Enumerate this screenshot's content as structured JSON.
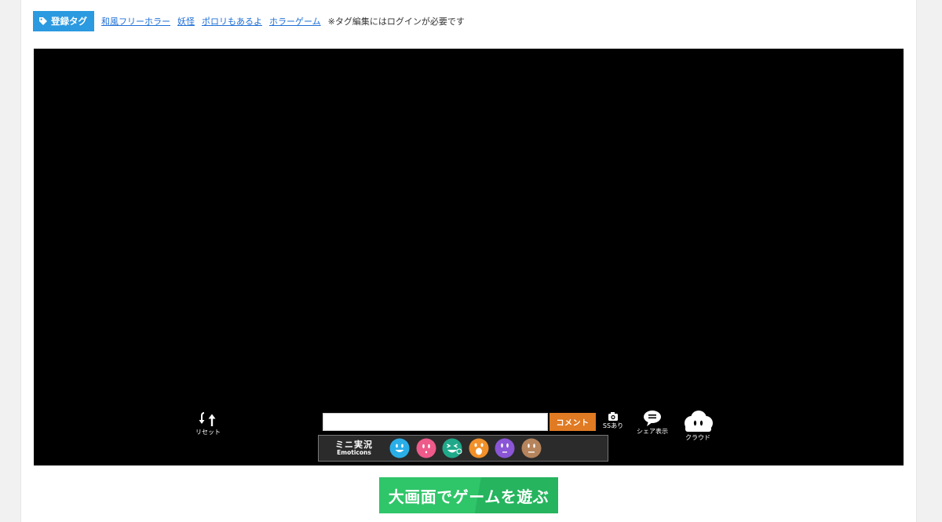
{
  "tags": {
    "badge_label": "登録タグ",
    "items": [
      "和風フリーホラー",
      "妖怪",
      "ポロリもあるよ",
      "ホラーゲーム"
    ],
    "note": "※タグ編集にはログインが必要です"
  },
  "controls": {
    "reset_label": "リセット",
    "comment_placeholder": "",
    "comment_button": "コメント",
    "ss_label": "SSあり",
    "share_label": "シェア表示",
    "cloud_label": "クラウド"
  },
  "emoticons": {
    "title": "ミニ実況",
    "subtitle": "Emoticons",
    "faces": [
      {
        "name": "smile-emoticon",
        "color": "#2aaee8"
      },
      {
        "name": "blush-emoticon",
        "color": "#ee5a8a"
      },
      {
        "name": "laugh-emoticon",
        "color": "#1fa98a"
      },
      {
        "name": "shock-emoticon",
        "color": "#f2902a"
      },
      {
        "name": "nervous-emoticon",
        "color": "#8a55d6"
      },
      {
        "name": "neutral-emoticon",
        "color": "#b5835c"
      }
    ]
  },
  "play_button": "大画面でゲームを遊ぶ",
  "colors": {
    "tag_badge": "#2b9ae0",
    "comment_button": "#e07a23",
    "play_button": "#2fc569"
  }
}
